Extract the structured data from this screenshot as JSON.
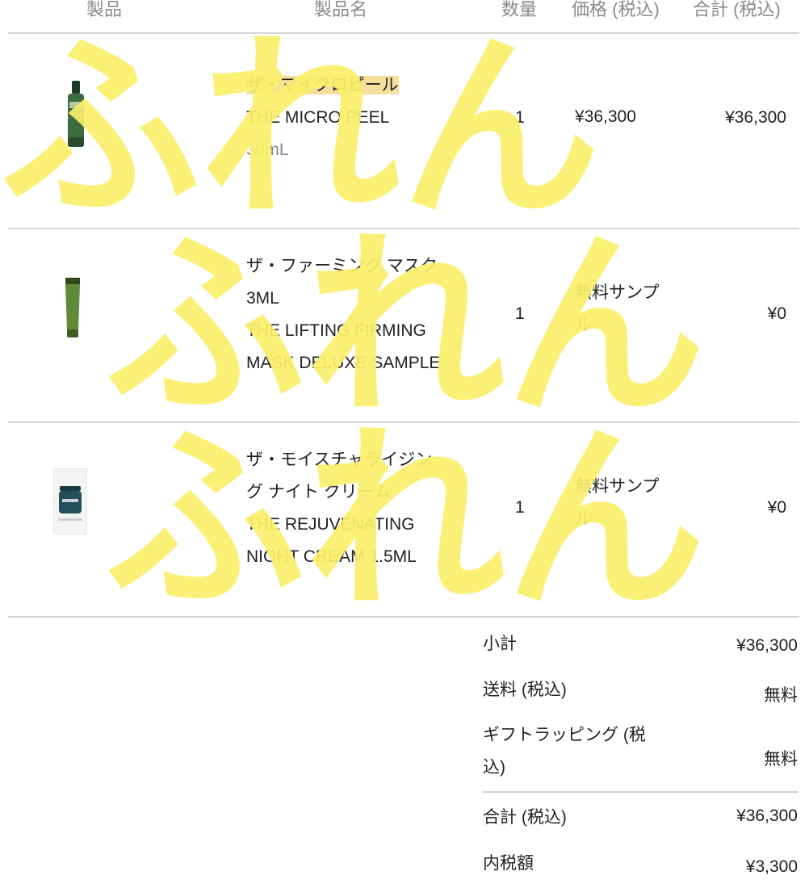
{
  "header": {
    "product": "製品",
    "product_name": "製品名",
    "quantity": "数量",
    "price": "価格 (税込)",
    "total": "合計 (税込)"
  },
  "items": [
    {
      "name_line1": "ザ・マイクロピール",
      "name_line2": "THE MICRO PEEL",
      "size": "30mL",
      "quantity": "1",
      "price": "¥36,300",
      "total": "¥36,300",
      "thumb_icon": "serum-bottle-icon"
    },
    {
      "name_line1": "ザ・ファーミング マスク",
      "name_line2": "3ML",
      "name_line3": "THE LIFTING FIRMING",
      "name_line4": "MASK DELUXE SAMPLE",
      "quantity": "1",
      "price_line1": "無料サンプ",
      "price_line2": "ル",
      "total": "¥0",
      "thumb_icon": "tube-icon"
    },
    {
      "name_line1": "ザ・モイスチャライジン",
      "name_line2": "グ ナイト クリーム",
      "name_line3": "THE REJUVENATING",
      "name_line4": "NIGHT CREAM 1.5ML",
      "quantity": "1",
      "price_line1": "無料サンプ",
      "price_line2": "ル",
      "total": "¥0",
      "thumb_icon": "cream-sachet-icon"
    }
  ],
  "summary": {
    "subtotal_label": "小計",
    "subtotal_value": "¥36,300",
    "shipping_label": "送料 (税込)",
    "shipping_value": "無料",
    "gift_label_line1": "ギフトラッピング (税",
    "gift_label_line2": "込)",
    "gift_value": "無料",
    "total_label": "合計 (税込)",
    "total_value": "¥36,300",
    "tax_label": "内税額",
    "tax_value": "¥3,300"
  },
  "watermark": {
    "text": "ふれん",
    "color": "#f9ef6a"
  }
}
